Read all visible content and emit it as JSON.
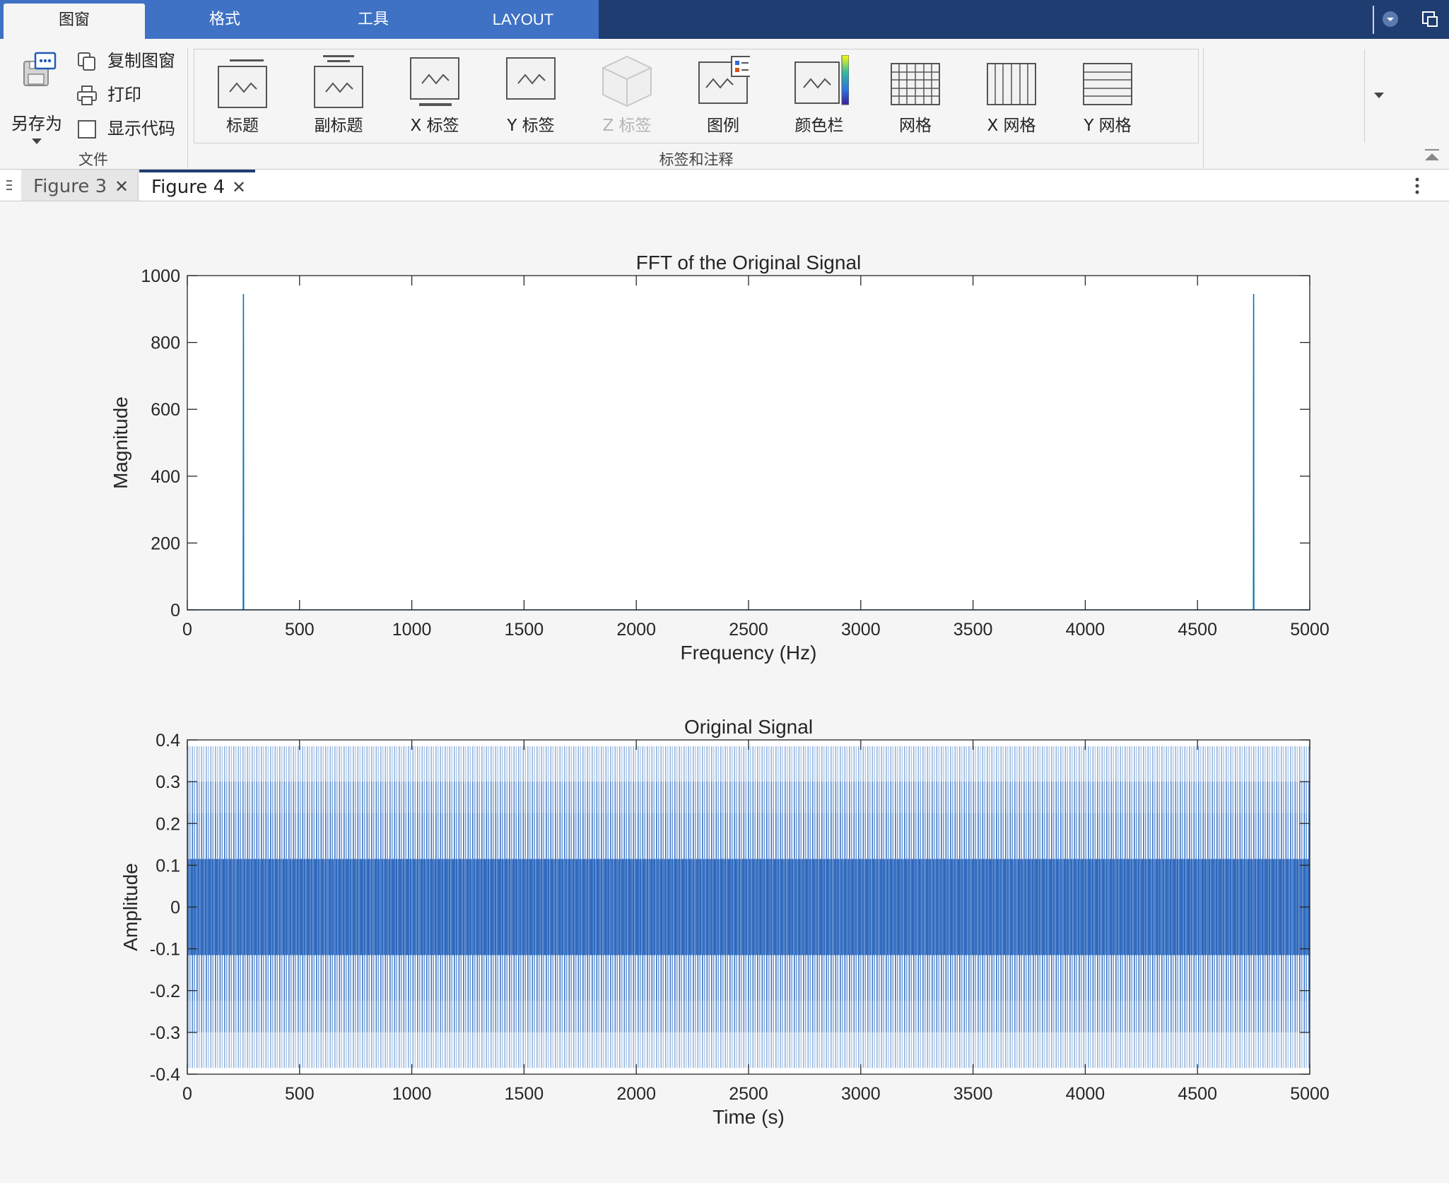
{
  "ribbon_tabs": [
    {
      "label": "图窗",
      "active": true
    },
    {
      "label": "格式",
      "active": false
    },
    {
      "label": "工具",
      "active": false
    },
    {
      "label": "LAYOUT",
      "active": false
    }
  ],
  "file_group": {
    "label": "文件",
    "save_as": "另存为",
    "copy_figure": "复制图窗",
    "print": "打印",
    "show_code": "显示代码"
  },
  "labels_group": {
    "label": "标签和注释",
    "buttons": [
      {
        "label": "标题",
        "icon": "title-icon",
        "enabled": true
      },
      {
        "label": "副标题",
        "icon": "subtitle-icon",
        "enabled": true
      },
      {
        "label": "X 标签",
        "icon": "x-label-icon",
        "enabled": true
      },
      {
        "label": "Y 标签",
        "icon": "y-label-icon",
        "enabled": true
      },
      {
        "label": "Z 标签",
        "icon": "z-label-icon",
        "enabled": false
      },
      {
        "label": "图例",
        "icon": "legend-icon",
        "enabled": true
      },
      {
        "label": "颜色栏",
        "icon": "colorbar-icon",
        "enabled": true
      },
      {
        "label": "网格",
        "icon": "grid-icon",
        "enabled": true
      },
      {
        "label": "X 网格",
        "icon": "x-grid-icon",
        "enabled": true
      },
      {
        "label": "Y 网格",
        "icon": "y-grid-icon",
        "enabled": true
      }
    ]
  },
  "doc_tabs": [
    {
      "label": "Figure 3",
      "active": false
    },
    {
      "label": "Figure 4",
      "active": true
    }
  ],
  "colors": {
    "ribbon_dark": "#1f3d71",
    "ribbon_tab_blue": "#3f72c4",
    "line_blue": "#0072bd"
  },
  "chart_data": [
    {
      "type": "line",
      "title": "FFT of the Original Signal",
      "xlabel": "Frequency (Hz)",
      "ylabel": "Magnitude",
      "xlim": [
        0,
        5000
      ],
      "ylim": [
        0,
        1000
      ],
      "xticks": [
        0,
        500,
        1000,
        1500,
        2000,
        2500,
        3000,
        3500,
        4000,
        4500,
        5000
      ],
      "yticks": [
        0,
        200,
        400,
        600,
        800,
        1000
      ],
      "series": [
        {
          "x": [
            0,
            249,
            250,
            251,
            4749,
            4750,
            4751,
            5000
          ],
          "y": [
            0,
            0,
            945,
            0,
            0,
            945,
            0,
            0
          ]
        }
      ]
    },
    {
      "type": "line",
      "title": "Original Signal",
      "xlabel": "Time (s)",
      "ylabel": "Amplitude",
      "xlim": [
        0,
        5000
      ],
      "ylim": [
        -0.4,
        0.4
      ],
      "xticks": [
        0,
        500,
        1000,
        1500,
        2000,
        2500,
        3000,
        3500,
        4000,
        4500,
        5000
      ],
      "yticks": [
        0.4,
        0.3,
        0.2,
        0.1,
        0,
        -0.1,
        -0.2,
        -0.3,
        -0.4
      ],
      "series": [
        {
          "signal": "dense oscillation",
          "amplitude_peak": 0.385,
          "amplitude_dense": 0.115
        }
      ]
    }
  ]
}
